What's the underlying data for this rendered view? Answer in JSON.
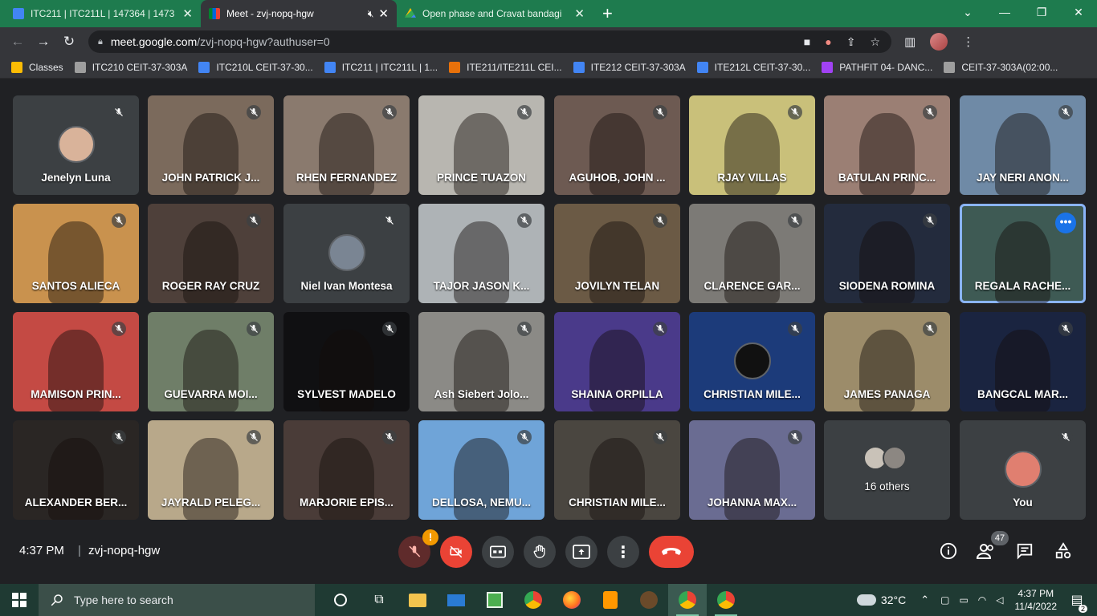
{
  "browser": {
    "tabs": [
      {
        "title": "ITC211 | ITC211L | 147364 | 1473",
        "icon": "classroom-icon",
        "color": "#4285f4",
        "active": false
      },
      {
        "title": "Meet - zvj-nopq-hgw",
        "icon": "meet-icon",
        "color": "#00897b",
        "active": true
      },
      {
        "title": "Open phase and Cravat bandagi",
        "icon": "drive-icon",
        "color": "#fbbc04",
        "active": false
      }
    ],
    "new_tab": "+",
    "url_domain": "meet.google.com",
    "url_path": "/zvj-nopq-hgw?authuser=0",
    "bookmarks": [
      {
        "label": "Classes",
        "color": "#fbbc04"
      },
      {
        "label": "ITC210 CEIT-37-303A",
        "color": "#9e9e9e"
      },
      {
        "label": "ITC210L CEIT-37-30...",
        "color": "#4285f4"
      },
      {
        "label": "ITC211 | ITC211L | 1...",
        "color": "#4285f4"
      },
      {
        "label": "ITE211/ITE211L CEI...",
        "color": "#e8710a"
      },
      {
        "label": "ITE212 CEIT-37-303A",
        "color": "#4285f4"
      },
      {
        "label": "ITE212L CEIT-37-30...",
        "color": "#4285f4"
      },
      {
        "label": "PATHFIT 04- DANC...",
        "color": "#a142f4"
      },
      {
        "label": "CEIT-37-303A(02:00...",
        "color": "#9e9e9e"
      }
    ]
  },
  "participants": [
    {
      "name": "Jenelyn Luna",
      "bg": "#3c4043",
      "avatar": "#d9b39a"
    },
    {
      "name": "JOHN PATRICK J...",
      "bg": "#7b6a5c"
    },
    {
      "name": "RHEN FERNANDEZ",
      "bg": "#8a7a6e"
    },
    {
      "name": "PRINCE TUAZON",
      "bg": "#b8b6b0"
    },
    {
      "name": "AGUHOB, JOHN ...",
      "bg": "#6d5a52"
    },
    {
      "name": "RJAY VILLAS",
      "bg": "#c9c07a"
    },
    {
      "name": "BATULAN PRINC...",
      "bg": "#9b7f74"
    },
    {
      "name": "JAY NERI ANON...",
      "bg": "#6f8aa6"
    },
    {
      "name": "SANTOS ALIECA",
      "bg": "#c9924e"
    },
    {
      "name": "ROGER RAY CRUZ",
      "bg": "#4e403a"
    },
    {
      "name": "Niel Ivan Montesa",
      "bg": "#3c4043",
      "avatar": "#7a8593"
    },
    {
      "name": "TAJOR JASON K...",
      "bg": "#aeb3b6"
    },
    {
      "name": "JOVILYN TELAN",
      "bg": "#6b5a45"
    },
    {
      "name": "CLARENCE GAR...",
      "bg": "#7c7a76"
    },
    {
      "name": "SIODENA ROMINA",
      "bg": "#232b3d"
    },
    {
      "name": "REGALA RACHE...",
      "bg": "#3e5a54",
      "highlight": true
    },
    {
      "name": "MAMISON PRIN...",
      "bg": "#c44a44"
    },
    {
      "name": "GUEVARRA MOI...",
      "bg": "#6f7e68"
    },
    {
      "name": "SYLVEST MADELO",
      "bg": "#101012"
    },
    {
      "name": "Ash Siebert Jolo...",
      "bg": "#8b8a86"
    },
    {
      "name": "SHAINA ORPILLA",
      "bg": "#4a3a8a"
    },
    {
      "name": "CHRISTIAN MILE...",
      "bg": "#1c3b7a",
      "avatar": "#111111"
    },
    {
      "name": "JAMES PANAGA",
      "bg": "#9c8c6a"
    },
    {
      "name": "BANGCAL MAR...",
      "bg": "#1a2440"
    },
    {
      "name": "ALEXANDER BER...",
      "bg": "#2a2624"
    },
    {
      "name": "JAYRALD PELEG...",
      "bg": "#b8a88a"
    },
    {
      "name": "MARJORIE EPIS...",
      "bg": "#4a3c38"
    },
    {
      "name": "DELLOSA, NEMU...",
      "bg": "#6fa4d8"
    },
    {
      "name": "CHRISTIAN MILE...",
      "bg": "#4a4640"
    },
    {
      "name": "JOHANNA MAX...",
      "bg": "#6a6c92"
    },
    {
      "name": "16 others",
      "bg": "#3c4043",
      "others": true
    },
    {
      "name": "You",
      "bg": "#3c4043",
      "avatar": "#e07f70"
    }
  ],
  "bottom": {
    "time": "4:37 PM",
    "separator": "|",
    "code": "zvj-nopq-hgw",
    "mic_warning": "!",
    "people_count": "47",
    "more": "⋮"
  },
  "taskbar": {
    "search_placeholder": "Type here to search",
    "temperature": "32°C",
    "clock_time": "4:37 PM",
    "clock_date": "11/4/2022",
    "notifications": "2"
  }
}
